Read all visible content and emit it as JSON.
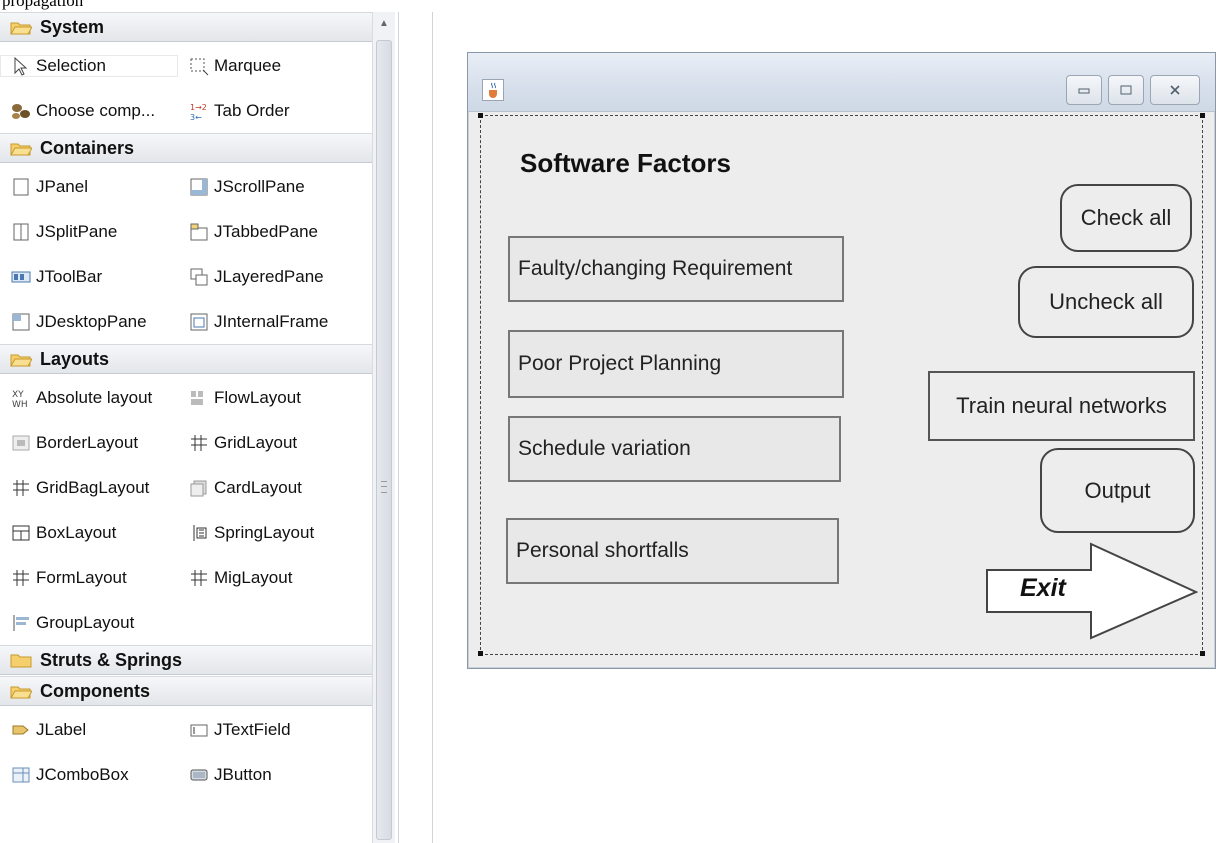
{
  "caption": "propagation",
  "palette": {
    "categories": [
      {
        "name": "System",
        "items": [
          [
            "Selection",
            "Marquee"
          ],
          [
            "Choose comp...",
            "Tab Order"
          ]
        ]
      },
      {
        "name": "Containers",
        "items": [
          [
            "JPanel",
            "JScrollPane"
          ],
          [
            "JSplitPane",
            "JTabbedPane"
          ],
          [
            "JToolBar",
            "JLayeredPane"
          ],
          [
            "JDesktopPane",
            "JInternalFrame"
          ]
        ]
      },
      {
        "name": "Layouts",
        "items": [
          [
            "Absolute layout",
            "FlowLayout"
          ],
          [
            "BorderLayout",
            "GridLayout"
          ],
          [
            "GridBagLayout",
            "CardLayout"
          ],
          [
            "BoxLayout",
            "SpringLayout"
          ],
          [
            "FormLayout",
            "MigLayout"
          ],
          [
            "GroupLayout",
            ""
          ]
        ]
      },
      {
        "name": "Struts & Springs",
        "items": []
      },
      {
        "name": "Components",
        "items": [
          [
            "JLabel",
            "JTextField"
          ],
          [
            "JComboBox",
            "JButton"
          ]
        ]
      }
    ]
  },
  "form": {
    "title": "Software Factors",
    "factors": [
      "Faulty/changing Requirement",
      "Poor Project Planning",
      "Schedule variation",
      "Personal shortfalls"
    ],
    "check_all": "Check all",
    "uncheck_all": "Uncheck all",
    "train": "Train neural networks",
    "output": "Output",
    "exit": "Exit"
  }
}
